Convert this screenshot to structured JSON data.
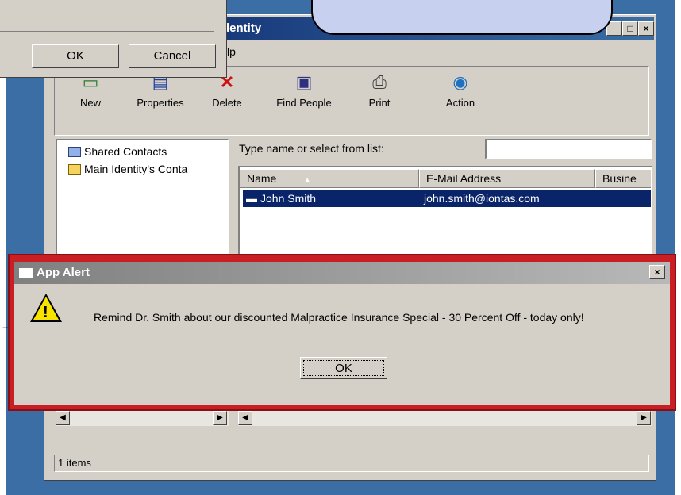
{
  "window": {
    "title": "dentity",
    "menu_fragment": "lp",
    "controls": {
      "minimize": "_",
      "maximize": "□",
      "close": "×"
    }
  },
  "toolbar": {
    "buttons": [
      {
        "label": "New",
        "icon": "new-icon"
      },
      {
        "label": "Properties",
        "icon": "properties-icon"
      },
      {
        "label": "Delete",
        "icon": "delete-icon"
      },
      {
        "label": "Find People",
        "icon": "find-people-icon"
      },
      {
        "label": "Print",
        "icon": "print-icon"
      },
      {
        "label": "Action",
        "icon": "action-icon"
      }
    ]
  },
  "tree": {
    "items": [
      "Shared Contacts",
      "Main Identity's Conta"
    ]
  },
  "search": {
    "label": "Type name or select from list:",
    "value": ""
  },
  "list": {
    "columns": [
      "Name",
      "E-Mail Address",
      "Busine"
    ],
    "rows": [
      {
        "name": "John Smith",
        "email": "john.smith@iontas.com",
        "business": ""
      }
    ]
  },
  "status": {
    "text": "1 items"
  },
  "top_dialog": {
    "ok": "OK",
    "cancel": "Cancel"
  },
  "alert": {
    "title": "App Alert",
    "message": "Remind Dr. Smith about our discounted Malpractice Insurance Special - 30 Percent Off - today only!",
    "ok": "OK",
    "close": "×",
    "highlight_color": "#c81e24"
  }
}
